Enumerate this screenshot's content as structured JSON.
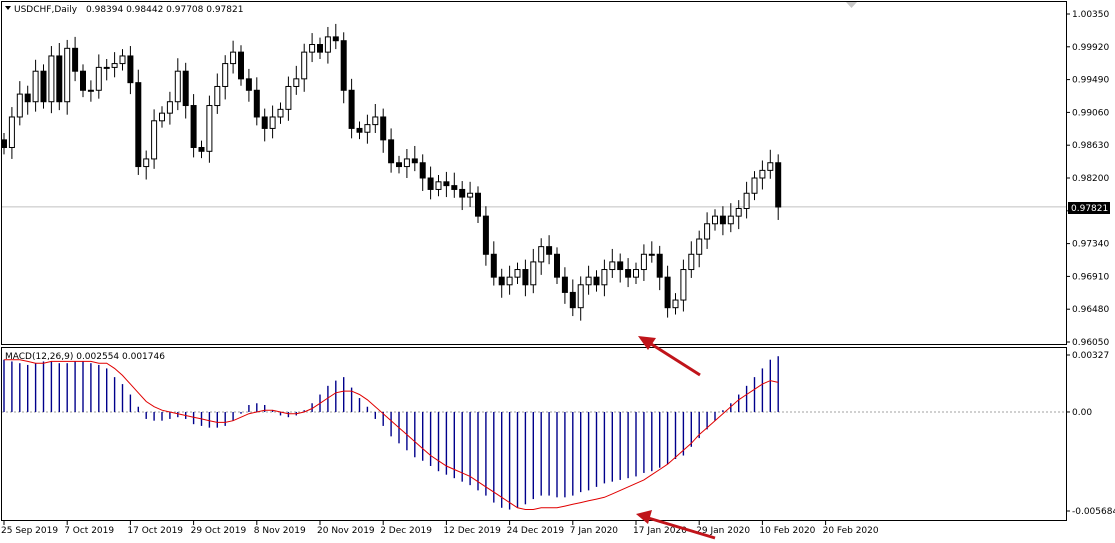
{
  "header": {
    "symbol": "USDCHF,Daily",
    "ohlc": "0.98394 0.98442 0.97708 0.97821",
    "macd_label": "MACD(12,26,9) 0.002554 0.001746"
  },
  "current_price_label": "0.97821",
  "colors": {
    "grid": "#c0c0c0",
    "price_line": "#c0c0c0",
    "macd_hist": "#00008b",
    "signal": "#e00000",
    "arrow": "#c0141a",
    "bull": "#ffffff",
    "bear": "#000000"
  },
  "chart_data": [
    {
      "type": "candlestick",
      "price_axis": {
        "min": 0.9605,
        "max": 1.0035,
        "ticks": [
          "1.00350",
          "0.99920",
          "0.99490",
          "0.99060",
          "0.98630",
          "0.98200",
          "0.97770",
          "0.97340",
          "0.96910",
          "0.96480",
          "0.96050"
        ]
      },
      "x_labels": [
        "25 Sep 2019",
        "7 Oct 2019",
        "17 Oct 2019",
        "29 Oct 2019",
        "8 Nov 2019",
        "20 Nov 2019",
        "2 Dec 2019",
        "12 Dec 2019",
        "24 Dec 2019",
        "7 Jan 2020",
        "17 Jan 2020",
        "29 Jan 2020",
        "10 Feb 2020",
        "20 Feb 2020"
      ],
      "x_label_bars": [
        0,
        8,
        16,
        24,
        32,
        40,
        48,
        56,
        64,
        72,
        80,
        88,
        96,
        104
      ],
      "current_price": 0.97821,
      "closes": [
        0.986,
        0.99,
        0.993,
        0.992,
        0.996,
        0.992,
        0.998,
        0.992,
        0.999,
        0.996,
        0.9935,
        0.9935,
        0.9965,
        0.9965,
        0.997,
        0.998,
        0.9945,
        0.9835,
        0.9845,
        0.9895,
        0.9905,
        0.992,
        0.996,
        0.9915,
        0.986,
        0.9855,
        0.9915,
        0.994,
        0.997,
        0.9985,
        0.995,
        0.9935,
        0.99,
        0.9885,
        0.99,
        0.991,
        0.994,
        0.995,
        0.9985,
        0.9995,
        0.9985,
        1.0005,
        1.0,
        0.9935,
        0.9885,
        0.988,
        0.989,
        0.99,
        0.987,
        0.984,
        0.9835,
        0.9845,
        0.984,
        0.982,
        0.9805,
        0.9815,
        0.981,
        0.9805,
        0.9795,
        0.98,
        0.977,
        0.972,
        0.969,
        0.968,
        0.969,
        0.97,
        0.968,
        0.971,
        0.973,
        0.972,
        0.969,
        0.967,
        0.965,
        0.968,
        0.969,
        0.968,
        0.97,
        0.971,
        0.97,
        0.969,
        0.97,
        0.972,
        0.972,
        0.969,
        0.965,
        0.966,
        0.97,
        0.972,
        0.974,
        0.976,
        0.977,
        0.976,
        0.977,
        0.978,
        0.98,
        0.982,
        0.983,
        0.984,
        0.9782
      ]
    },
    {
      "type": "bar",
      "title": "MACD(12,26,9)",
      "value_axis": {
        "min": -0.005684,
        "max": 0.00327,
        "ticks": [
          "0.00327",
          "0.00",
          "-0.005684"
        ]
      },
      "macd_histogram": [
        0.003,
        0.0029,
        0.0028,
        0.0027,
        0.0028,
        0.0029,
        0.0029,
        0.0028,
        0.0028,
        0.0029,
        0.0029,
        0.0028,
        0.0027,
        0.0025,
        0.002,
        0.0016,
        0.001,
        0.0003,
        -0.0004,
        -0.0005,
        -0.0005,
        -0.0004,
        -0.0003,
        -0.0004,
        -0.0007,
        -0.0008,
        -0.0009,
        -0.0009,
        -0.0008,
        -0.0005,
        -0.0001,
        0.0004,
        0.0005,
        0.0004,
        0.0001,
        -0.0002,
        -0.0003,
        -0.0002,
        0.0001,
        0.0005,
        0.001,
        0.0015,
        0.0018,
        0.002,
        0.0014,
        0.0008,
        0.0003,
        -0.0004,
        -0.0008,
        -0.0014,
        -0.0018,
        -0.0022,
        -0.0026,
        -0.0028,
        -0.0031,
        -0.0034,
        -0.0036,
        -0.0038,
        -0.004,
        -0.0042,
        -0.0045,
        -0.0048,
        -0.0052,
        -0.0055,
        -0.0056,
        -0.0055,
        -0.0053,
        -0.005,
        -0.0048,
        -0.0048,
        -0.0049,
        -0.0049,
        -0.0048,
        -0.0046,
        -0.0045,
        -0.0043,
        -0.0041,
        -0.004,
        -0.0039,
        -0.0038,
        -0.0037,
        -0.0035,
        -0.0034,
        -0.0032,
        -0.003,
        -0.0027,
        -0.0025,
        -0.002,
        -0.0015,
        -0.001,
        -0.0005,
        0.0001,
        0.0005,
        0.001,
        0.0015,
        0.002,
        0.0025,
        0.003,
        0.0032
      ],
      "signal_line": [
        0.003,
        0.003,
        0.003,
        0.0029,
        0.0028,
        0.0028,
        0.0029,
        0.0029,
        0.0029,
        0.0029,
        0.0029,
        0.0029,
        0.0028,
        0.0028,
        0.0025,
        0.0021,
        0.0016,
        0.0011,
        0.0006,
        0.0003,
        0.0001,
        0.0,
        -0.0001,
        -0.0002,
        -0.0003,
        -0.0004,
        -0.0005,
        -0.0006,
        -0.0006,
        -0.0005,
        -0.0003,
        -0.0001,
        0.0,
        0.0001,
        0.0001,
        0.0,
        -0.0001,
        -0.0001,
        0.0,
        0.0002,
        0.0005,
        0.0008,
        0.0011,
        0.0012,
        0.0012,
        0.001,
        0.0007,
        0.0003,
        -0.0001,
        -0.0005,
        -0.0009,
        -0.0013,
        -0.0017,
        -0.0021,
        -0.0025,
        -0.0028,
        -0.0031,
        -0.0033,
        -0.0035,
        -0.0037,
        -0.004,
        -0.0043,
        -0.0046,
        -0.0049,
        -0.0052,
        -0.0055,
        -0.0056,
        -0.0056,
        -0.0055,
        -0.0055,
        -0.0055,
        -0.0054,
        -0.0053,
        -0.0052,
        -0.0051,
        -0.005,
        -0.0049,
        -0.0047,
        -0.0045,
        -0.0043,
        -0.0041,
        -0.0039,
        -0.0036,
        -0.0033,
        -0.003,
        -0.0026,
        -0.0022,
        -0.0018,
        -0.0013,
        -0.0009,
        -0.0005,
        -0.0001,
        0.0003,
        0.0007,
        0.001,
        0.0013,
        0.0016,
        0.0018,
        0.0017
      ]
    }
  ]
}
